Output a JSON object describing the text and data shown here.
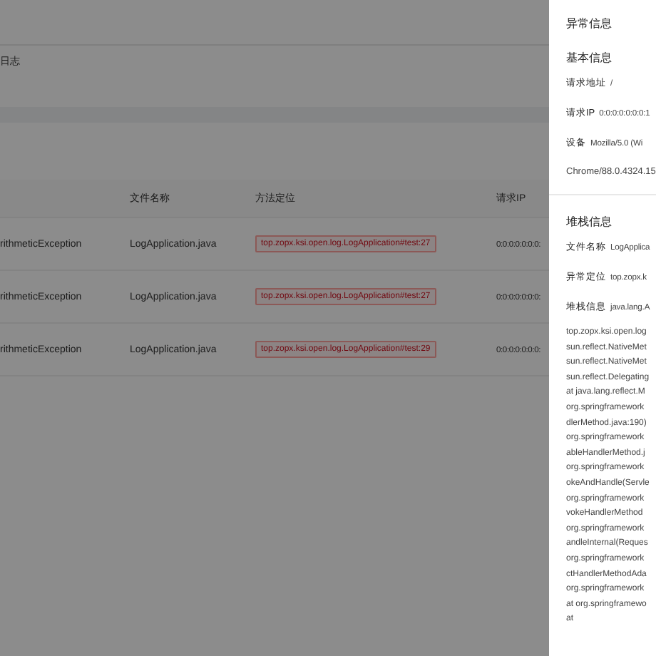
{
  "page": {
    "breadcrumb": "日志"
  },
  "table": {
    "columns": [
      "文件名称",
      "方法定位",
      "请求IP"
    ],
    "rows": [
      {
        "column_1": "rithmeticException",
        "file": "LogApplication.java",
        "method": "top.zopx.ksi.open.log.LogApplication#test:27",
        "ip": "0:0:0:0:0:0:0:"
      },
      {
        "column_1": "rithmeticException",
        "file": "LogApplication.java",
        "method": "top.zopx.ksi.open.log.LogApplication#test:27",
        "ip": "0:0:0:0:0:0:0:"
      },
      {
        "column_1": "rithmeticException",
        "file": "LogApplication.java",
        "method": "top.zopx.ksi.open.log.LogApplication#test:29",
        "ip": "0:0:0:0:0:0:0:"
      }
    ]
  },
  "drawer": {
    "title": "异常信息",
    "basic": {
      "heading": "基本信息",
      "fields": [
        {
          "label": "请求地址",
          "value": "/"
        },
        {
          "label": "请求IP",
          "value": "0:0:0:0:0:0:0:1"
        },
        {
          "label": "设备",
          "value": "Mozilla/5.0 (Wi"
        }
      ],
      "continuation": "Chrome/88.0.4324.15"
    },
    "stack": {
      "heading": "堆栈信息",
      "fields": [
        {
          "label": "文件名称",
          "value": "LogApplica"
        },
        {
          "label": "异常定位",
          "value": "top.zopx.k"
        },
        {
          "label": "堆栈信息",
          "value": "java.lang.A"
        }
      ],
      "lines": [
        "top.zopx.ksi.open.log",
        "sun.reflect.NativeMet",
        "sun.reflect.NativeMet",
        "sun.reflect.Delegating",
        "at java.lang.reflect.M",
        "org.springframework",
        "dlerMethod.java:190)",
        "org.springframework",
        "ableHandlerMethod.j",
        "org.springframework",
        "okeAndHandle(Servle",
        "org.springframework",
        "vokeHandlerMethod",
        "org.springframework",
        "andleInternal(Reques",
        "org.springframework",
        "ctHandlerMethodAda",
        "org.springframework",
        "at org.springframewo",
        "at"
      ]
    }
  }
}
